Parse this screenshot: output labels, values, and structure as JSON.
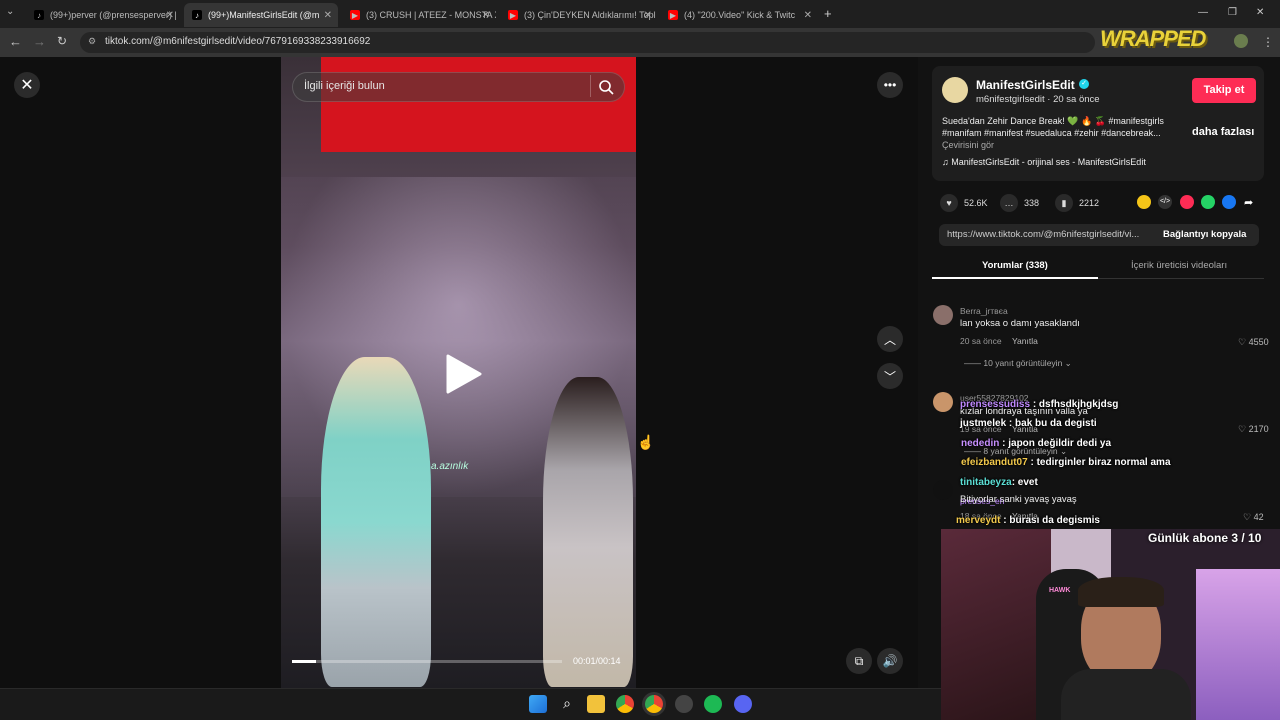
{
  "browser": {
    "tabs": [
      {
        "label": "(99+)perver (@prensesperver) |",
        "icon": "tiktok-icon",
        "active": false
      },
      {
        "label": "(99+)ManifestGirlsEdit (@m",
        "icon": "tiktok-icon",
        "active": true
      },
      {
        "label": "(3) CRUSH | ATEEZ - MONSTA X",
        "icon": "youtube-icon",
        "active": false
      },
      {
        "label": "(3) Çin'DEYKEN Aldıklarımı! Topl",
        "icon": "youtube-icon",
        "active": false
      },
      {
        "label": "(4) \"200.Video\" Kick & Twitc",
        "icon": "youtube-icon",
        "active": false
      }
    ],
    "new_tab": "+",
    "url": "tiktok.com/@m6nifestgirlsedit/video/7679169338233916692",
    "window_controls": [
      "—",
      "❐",
      "✕"
    ]
  },
  "overlay_logo": "WRAPPED",
  "video": {
    "search_placeholder": "İlgili içeriği bulun",
    "time": "00:01/00:14",
    "progress": 0.09,
    "watermark": "a.azınlık"
  },
  "post": {
    "username": "ManifestGirlsEdit",
    "handle": "m6nifestgirlsedit · 20 sa önce",
    "follow_label": "Takip et",
    "description_line1": "Sueda'dan Zehir Dance Break! 💚 🔥 🍒  #manifestgirls",
    "description_line2": "#manifam #manifest #suedaluca #zehir #dancebreak...",
    "see_translation": "Çevirisini gör",
    "more_label": "daha fazlası",
    "music": "ManifestGirlsEdit - orijinal ses - ManifestGirlsEdit",
    "likes": "52.6K",
    "comments": "338",
    "saves": "2212",
    "link": "https://www.tiktok.com/@m6nifestgirlsedit/vi...",
    "copy_link_label": "Bağlantıyı kopyala",
    "tab_comments": "Yorumlar (338)",
    "tab_creator": "İçerik üreticisi videoları"
  },
  "comments": [
    {
      "user": "Berra_jrтвєa",
      "text": "lan yoksa o damı yasaklandı",
      "time": "20 sa önce",
      "reply": "Yanıtla",
      "likes": "4550",
      "replies": "10 yanıt görüntüleyin"
    },
    {
      "user": "user55827829102",
      "text": "kızlar londraya taşının valla ya",
      "time": "19 sa önce",
      "reply": "Yanıtla",
      "likes": "2170",
      "replies": "8 yanıt görüntüleyin"
    },
    {
      "user": "prenses_eh",
      "text": "Bitiyorlar sanki yavaş yavaş",
      "time": "18 sa önce",
      "reply": "Yanıtla",
      "likes": "42"
    }
  ],
  "chat": [
    {
      "name": "prensessudiss",
      "text": ": dsfhsdkjhgkjdsg",
      "color": "#c08aff"
    },
    {
      "name": "justmelek",
      "text": ": bak bu da degisti",
      "color": "#ffffff"
    },
    {
      "name": "nededin",
      "text": ": japon değildir dedi ya",
      "color": "#c790ff"
    },
    {
      "name": "efeizbandut07",
      "text": ": tedirginler biraz normal ama",
      "color": "#f2c94c"
    },
    {
      "name": "tinitabeyza",
      "text": ": evet",
      "color": "#5ce0d6"
    },
    {
      "name": "merveydt",
      "text": ": burası da degismis",
      "color": "#f2c94c"
    }
  ],
  "webcam": {
    "sub_goal": "Günlük abone 3 / 10",
    "chair_brand": "HAWK"
  }
}
